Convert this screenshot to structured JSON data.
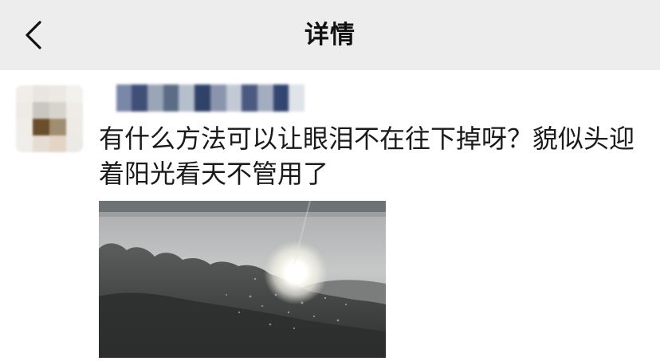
{
  "navbar": {
    "back_icon": "chevron-left-icon",
    "title": "详情"
  },
  "post": {
    "author_name": "",
    "text": "有什么方法可以让眼泪不在往下掉呀？貌似头迎着阳光看天不管用了",
    "image_description_icon": "photo-icon"
  },
  "colors": {
    "navbar_bg": "#ededed",
    "page_bg": "#ffffff",
    "text": "#1a1a1a"
  }
}
